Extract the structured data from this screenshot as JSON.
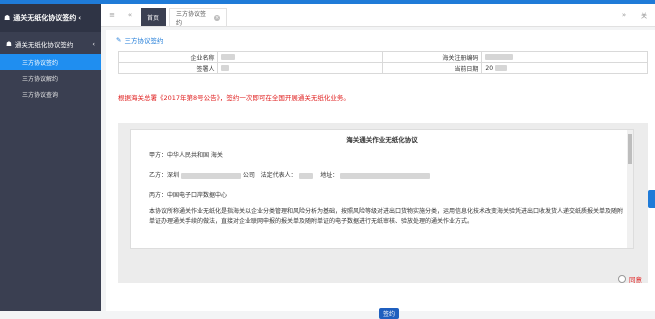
{
  "sidebar": {
    "title": "通关无纸化协议签约",
    "group_label": "通关无纸化协议签约",
    "items": [
      {
        "label": "三方协议签约"
      },
      {
        "label": "三方协议解约"
      },
      {
        "label": "三方协议查询"
      }
    ]
  },
  "tabbar": {
    "home_label": "首页",
    "current_tab_label": "三方协议签约",
    "right_label": "关"
  },
  "panel": {
    "title": "三方协议签约",
    "info": {
      "company_name_label": "企业名称",
      "customs_code_label": "海关注册编码",
      "signer_label": "签署人",
      "date_label": "当前日期",
      "date_value": "20"
    },
    "notice": "根据海关总署《2017年第8号公告》，签约一次即可在全国开展通关无纸化业务。"
  },
  "agreement": {
    "title": "海关通关作业无纸化协议",
    "party_a": "甲方：中华人民共和国        海关",
    "party_b_prefix": "乙方：深圳",
    "party_b_company": "公司",
    "party_b_rep_label": "法定代表人：",
    "party_b_addr_label": "地址：",
    "party_c": "丙方：中国电子口岸数据中心",
    "body": "本协议所称通关作业无纸化是指海关以企业分类管理和风险分析为基础，按照风险等级对进出口货物实施分类，运用信息化技术改变海关验凭进出口收发货人递交纸质报关单及随附单证办理通关手续的做法，直接对企业联网申报的报关单及随附单证的电子数据进行无纸审核、验放处理的通关作业方式。",
    "agree_label": "同意",
    "sign_button": "签约"
  },
  "colors": {
    "accent": "#1f7bd8",
    "sidebar_bg": "#3a3f51",
    "active_item": "#1f8ef0",
    "notice": "#e02020"
  }
}
